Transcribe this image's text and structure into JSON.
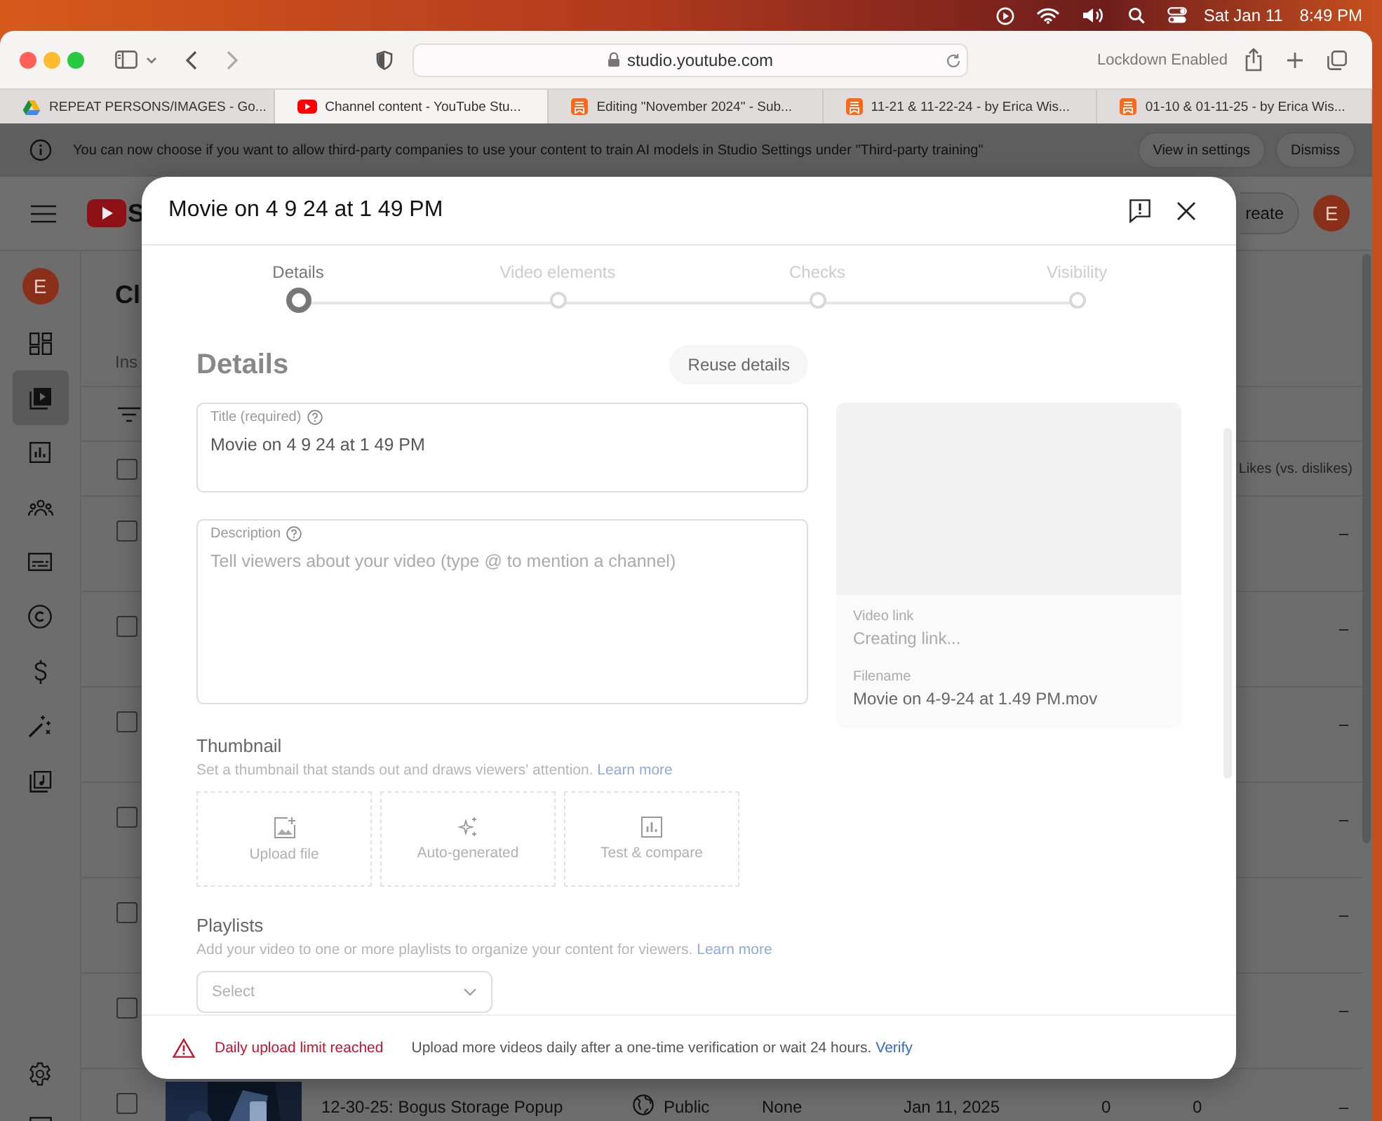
{
  "menu_bar": {
    "date": "Sat Jan 11",
    "time": "8:49 PM"
  },
  "browser": {
    "address": "studio.youtube.com",
    "lockdown": "Lockdown Enabled",
    "tabs": [
      {
        "kind": "drive",
        "title": "REPEAT PERSONS/IMAGES - Go...",
        "selected": false
      },
      {
        "kind": "youtube",
        "title": "Channel content - YouTube Stu...",
        "selected": true
      },
      {
        "kind": "bookmark",
        "title": "Editing \"November 2024\" - Sub...",
        "selected": false
      },
      {
        "kind": "bookmark",
        "title": "11-21 & 11-22-24 - by Erica Wis...",
        "selected": false
      },
      {
        "kind": "bookmark",
        "title": "01-10 & 01-11-25 - by Erica Wis...",
        "selected": false
      }
    ]
  },
  "banner": {
    "text": "You can now choose if you want to allow third-party companies to use your content to train AI models in Studio Settings under \"Third-party training\"",
    "buttons": [
      "View in settings",
      "Dismiss"
    ]
  },
  "studio": {
    "logo_text": "S",
    "create_label": "reate",
    "avatar_initial": "E",
    "nav_avatar_initial": "E",
    "page_title": "Cl",
    "tab_label": "Ins",
    "nav": [
      {
        "kind": "dashboard",
        "selected": false
      },
      {
        "kind": "content",
        "selected": true
      },
      {
        "kind": "analytics",
        "selected": false
      },
      {
        "kind": "community",
        "selected": false
      },
      {
        "kind": "subtitles",
        "selected": false
      },
      {
        "kind": "copyright",
        "selected": false
      },
      {
        "kind": "earn",
        "selected": false
      },
      {
        "kind": "customization",
        "selected": false
      },
      {
        "kind": "audio",
        "selected": false
      }
    ],
    "nav_bottom": [
      {
        "kind": "settings",
        "selected": false
      },
      {
        "kind": "feedback",
        "selected": false
      }
    ]
  },
  "table": {
    "header_checked": false,
    "header_last": "Likes (vs. dislikes)",
    "rows": [
      {
        "checked": false,
        "likes": "–"
      },
      {
        "checked": false,
        "likes": "–"
      },
      {
        "checked": false,
        "likes": "–"
      },
      {
        "checked": false,
        "likes": "–"
      },
      {
        "checked": false,
        "likes": "–"
      },
      {
        "checked": false,
        "likes": "–"
      }
    ],
    "last_row": {
      "checked": false,
      "title": "12-30-25: Bogus Storage Popup",
      "visibility": "Public",
      "restrictions": "None",
      "date": "Jan 11, 2025",
      "views": "0",
      "comments": "0",
      "likes": "–"
    }
  },
  "dialog": {
    "title": "Movie on 4 9 24 at 1 49 PM",
    "steps": [
      {
        "label": "Details",
        "selected": true
      },
      {
        "label": "Video elements",
        "selected": false
      },
      {
        "label": "Checks",
        "selected": false
      },
      {
        "label": "Visibility",
        "selected": false
      }
    ],
    "section_title": "Details",
    "reuse_button": "Reuse details",
    "title_field": {
      "label": "Title (required)",
      "value": "Movie on 4 9 24 at 1 49 PM"
    },
    "description_field": {
      "label": "Description",
      "placeholder": "Tell viewers about your video (type @ to mention a channel)"
    },
    "preview": {
      "link_label": "Video link",
      "link_value": "Creating link...",
      "filename_label": "Filename",
      "filename": "Movie on 4-9-24 at 1.49 PM.mov"
    },
    "thumbnail": {
      "heading": "Thumbnail",
      "text": "Set a thumbnail that stands out and draws viewers' attention.",
      "link": "Learn more",
      "options": [
        {
          "kind": "upload",
          "label": "Upload file"
        },
        {
          "kind": "auto",
          "label": "Auto-generated"
        },
        {
          "kind": "test",
          "label": "Test & compare"
        }
      ]
    },
    "playlists": {
      "heading": "Playlists",
      "text": "Add your video to one or more playlists to organize your content for viewers.",
      "link": "Learn more",
      "select_placeholder": "Select"
    },
    "footer": {
      "alert": "Daily upload limit reached",
      "message": "Upload more videos daily after a one-time verification or wait 24 hours.",
      "link": "Verify"
    }
  }
}
